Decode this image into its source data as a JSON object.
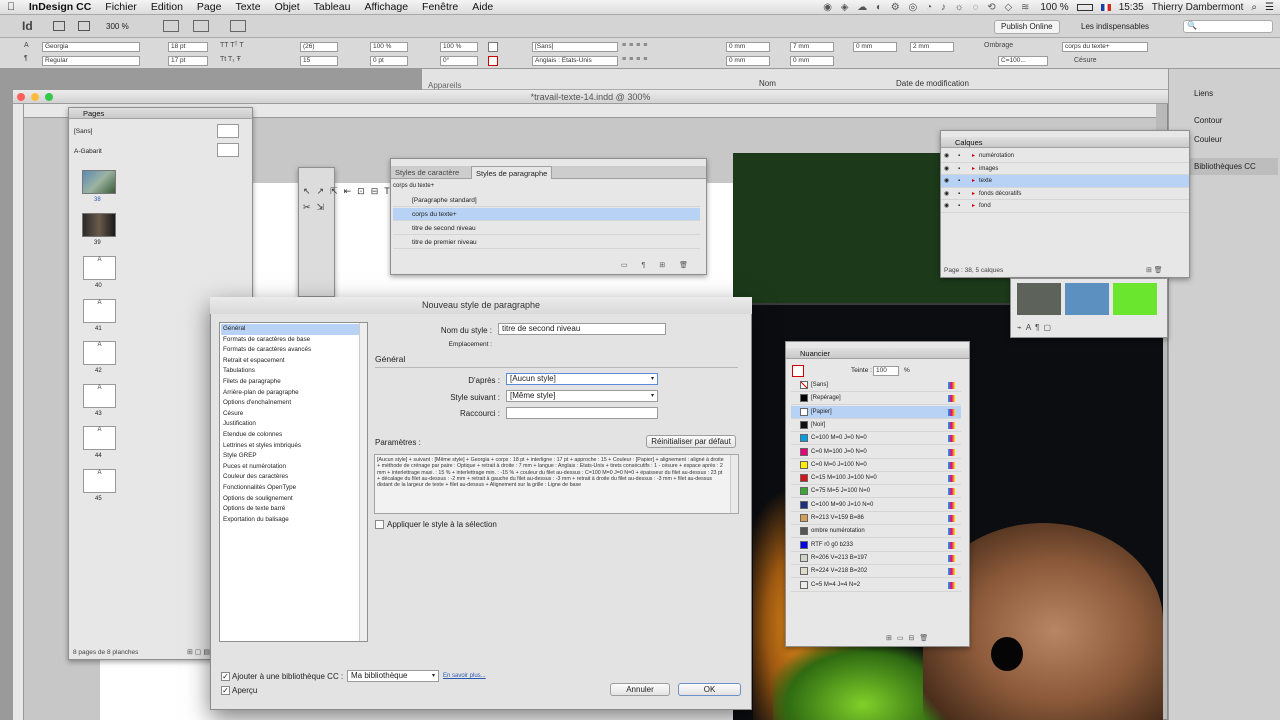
{
  "menubar": {
    "app": "InDesign CC",
    "items": [
      "Fichier",
      "Edition",
      "Page",
      "Texte",
      "Objet",
      "Tableau",
      "Affichage",
      "Fenêtre",
      "Aide"
    ],
    "battery": "100 %",
    "time": "15:35",
    "user": "Thierry Dambermont"
  },
  "appbar": {
    "zoom": "300 %",
    "publish": "Publish Online",
    "workspace": "Les indispensables",
    "search_placeholder": "🔍"
  },
  "controlbar": {
    "font": "Georgia",
    "style": "Regular",
    "size": "18 pt",
    "leading": "17 pt",
    "tracking": "(26)",
    "kerning": "15",
    "hscale": "100 %",
    "vscale": "100 %",
    "baseline": "0 pt",
    "angle": "0°",
    "charstyle": "[Sans]",
    "language": "Anglais : Etats-Unis",
    "indent1": "0 mm",
    "indent2": "0 mm",
    "indent3": "7 mm",
    "indent4": "0 mm",
    "space1": "0 mm",
    "space2": "2 mm",
    "shading": "Ombrage",
    "parastyle": "corps du texte+",
    "cesure": "Césure",
    "bgfield": "C=100..."
  },
  "bgdoc": {
    "title": "*travail-texte-14.indd @ 300%",
    "appareils": "Appareils",
    "nom": "Nom",
    "date": "Date de modification"
  },
  "rdock": {
    "items": [
      "Liens",
      "Contour",
      "Couleur",
      "Bibliothèques CC"
    ]
  },
  "pages": {
    "title": "Pages",
    "masters": [
      "[Sans]",
      "A-Gabarit"
    ],
    "numbers": [
      "38",
      "39",
      "40",
      "41",
      "42",
      "43",
      "44",
      "45"
    ],
    "footer": "8 pages de 8 planches",
    "letter": "A"
  },
  "styles": {
    "tab1": "Styles de caractère",
    "tab2": "Styles de paragraphe",
    "current": "corps du texte+",
    "items": [
      "[Paragraphe standard]",
      "corps du texte+",
      "titre de second niveau",
      "titre de premier niveau"
    ]
  },
  "calques": {
    "title": "Calques",
    "items": [
      "numérotation",
      "images",
      "texte",
      "fonds décoratifs",
      "fond"
    ],
    "footer": "Page : 38, 5 calques"
  },
  "nuancier": {
    "title": "Nuancier",
    "teinte_label": "Teinte :",
    "teinte": "100",
    "pct": "%",
    "items": [
      "[Sans]",
      "[Repérage]",
      "[Papier]",
      "[Noir]",
      "C=100 M=0 J=0 N=0",
      "C=0 M=100 J=0 N=0",
      "C=0 M=0 J=100 N=0",
      "C=15 M=100 J=100 N=0",
      "C=75 M=5 J=100 N=0",
      "C=100 M=90 J=10 N=0",
      "R=213 V=159 B=86",
      "ombre numérotation",
      "RTF r0 g0 b233",
      "R=206 V=213 B=197",
      "R=224 V=218 B=202",
      "C=5 M=4 J=4 N=2"
    ],
    "colors": [
      "none",
      "#000000",
      "#ffffff",
      "#111111",
      "#00a0e0",
      "#e6007e",
      "#ffec00",
      "#d6141c",
      "#3ba535",
      "#1a2f80",
      "#d59f56",
      "#555555",
      "#0000e9",
      "#ced5c5",
      "#e0daca",
      "#ebebea"
    ]
  },
  "colorgroup": {
    "colors": [
      "#5d635b",
      "#5c90c0",
      "#6ae62e"
    ]
  },
  "dialog": {
    "title": "Nouveau style de paragraphe",
    "categories": [
      "Général",
      "Formats de caractères de base",
      "Formats de caractères avancés",
      "Retrait et espacement",
      "Tabulations",
      "Filets de paragraphe",
      "Arrière-plan de paragraphe",
      "Options d'enchaînement",
      "Césure",
      "Justification",
      "Etendue de colonnes",
      "Lettrines et styles imbriqués",
      "Style GREP",
      "Puces et numérotation",
      "Couleur des caractères",
      "Fonctionnalités OpenType",
      "Options de soulignement",
      "Options de texte barré",
      "Exportation du balisage"
    ],
    "name_label": "Nom du style :",
    "name_value": "titre de second niveau",
    "emplacement_label": "Emplacement :",
    "section": "Général",
    "apres_label": "D'après :",
    "apres_value": "[Aucun style]",
    "suivant_label": "Style suivant :",
    "suivant_value": "[Même style]",
    "raccourci_label": "Raccourci :",
    "params_label": "Paramètres :",
    "reset": "Réinitialiser par défaut",
    "params_text": "[Aucun style] + suivant : [Même style] + Georgia + corps : 18 pt + interligne : 17 pt + approche : 15 + Couleur : [Papier] + alignement : aligné à droite + méthode de crénage par paire : Optique + retrait à droite : 7 mm + langue : Anglais : Etats-Unis + tirets consécutifs : 1 - césure + espace après : 2 mm + interlettrage maxi. : 15 % + interlettrage min. : -15 % + couleur du filet au-dessus : C=100 M=0 J=0 N=0 + épaisseur du filet au-dessus : 23 pt + décalage du filet au-dessus : -2 mm + retrait à gauche du filet au-dessus : -3 mm + retrait à droite du filet au-dessus : -3 mm + filet au-dessus distant de la largeur de texte + filet au-dessus + Alignement sur la grille : Ligne de base",
    "apply_label": "Appliquer le style à la sélection",
    "add_cc_label": "Ajouter à une bibliothèque CC :",
    "library": "Ma bibliothèque",
    "learn_more": "En savoir plus...",
    "preview_label": "Aperçu",
    "cancel": "Annuler",
    "ok": "OK"
  }
}
